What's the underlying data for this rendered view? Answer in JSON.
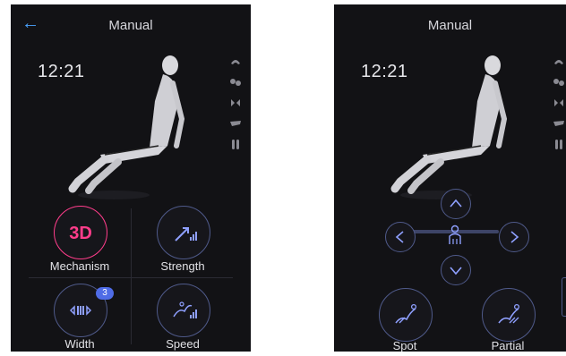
{
  "left_screen": {
    "title": "Manual",
    "time": "12:21",
    "zone_icons": [
      "head-icon",
      "shoulder-icon",
      "back-icon",
      "waist-icon",
      "legs-icon"
    ],
    "controls": [
      {
        "label": "Mechanism",
        "icon_text": "3D",
        "icon": "3d-mechanism-icon"
      },
      {
        "label": "Strength",
        "icon": "strength-icon"
      },
      {
        "label": "Width",
        "icon": "width-icon",
        "badge": "3"
      },
      {
        "label": "Speed",
        "icon": "speed-icon"
      }
    ]
  },
  "right_screen": {
    "title": "Manual",
    "time": "12:21",
    "zone_icons": [
      "head-icon",
      "shoulder-icon",
      "back-icon",
      "waist-icon",
      "legs-icon"
    ],
    "dpad": [
      "up-arrow-icon",
      "left-arrow-icon",
      "right-arrow-icon",
      "down-arrow-icon",
      "body-position-icon"
    ],
    "modes": [
      {
        "label": "Spot",
        "icon": "spot-icon"
      },
      {
        "label": "Partial",
        "icon": "partial-icon"
      }
    ]
  },
  "colors": {
    "background": "#121215",
    "accent": "#4aa3ff",
    "ring": "#4f5a8a",
    "mechanism": "#ff3d8b"
  }
}
